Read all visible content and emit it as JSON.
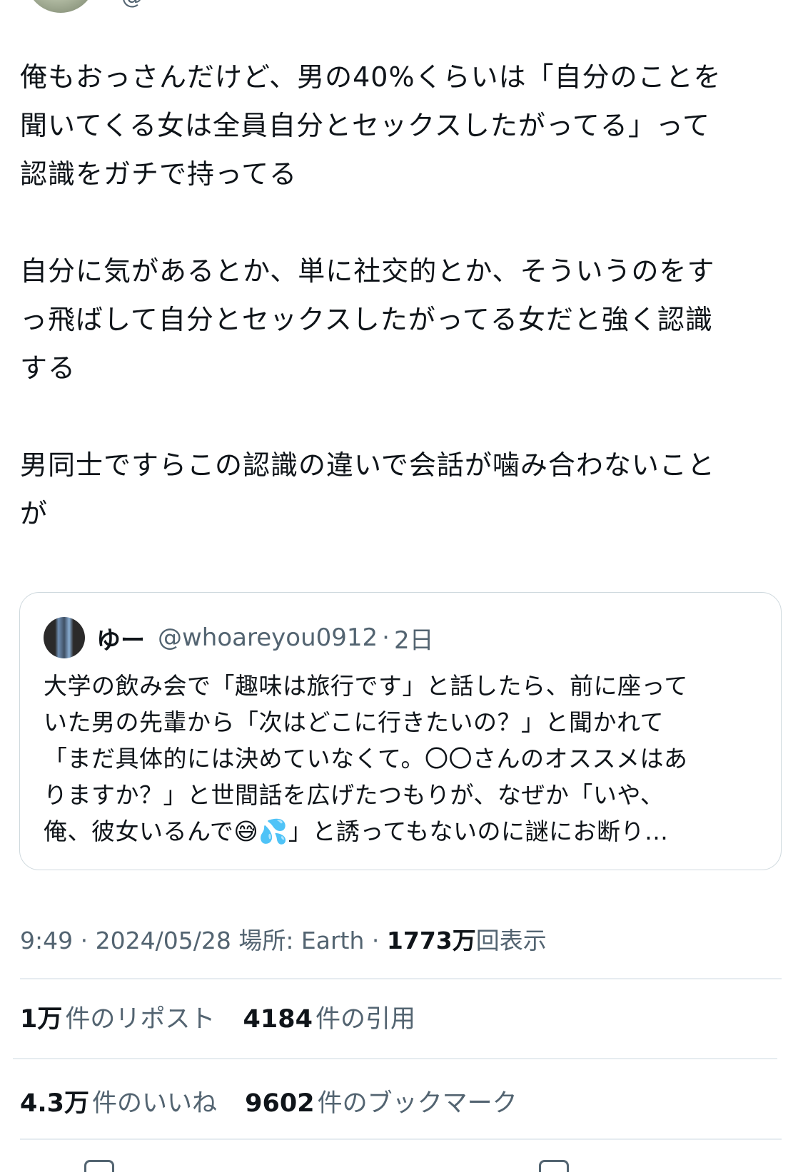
{
  "tweet": {
    "partial_header": "@",
    "text": "俺もおっさんだけど、男の40%くらいは「自分のことを\n聞いてくる女は全員自分とセックスしたがってる」って\n認識をガチで持ってる\n\n自分に気があるとか、単に社交的とか、そういうのをす\nっ飛ばして自分とセックスしたがってる女だと強く認識\nする\n\n男同士ですらこの認識の違いで会話が噛み合わないこと\nが"
  },
  "quote": {
    "display_name": "ゆー",
    "handle": "@whoareyou0912",
    "separator": "·",
    "time": "2日",
    "text": "大学の飲み会で「趣味は旅行です」と話したら、前に座って\nいた男の先輩から「次はどこに行きたいの？」と聞かれて\n「まだ具体的には決めていなくて。〇〇さんのオススメはあ\nりますか？」と世間話を広げたつもりが、なぜか「いや、\n俺、彼女いるんで😅💦」と誘ってもないのに謎にお断り…"
  },
  "meta": {
    "time": "9:49",
    "sep1": "·",
    "date": "2024/05/28",
    "location": "場所: Earth",
    "sep2": "·",
    "views_count": "1773万",
    "views_label": "回表示"
  },
  "stats": {
    "reposts_count": "1万",
    "reposts_label": "件のリポスト",
    "quotes_count": "4184",
    "quotes_label": "件の引用",
    "likes_count": "4.3万",
    "likes_label": "件のいいね",
    "bookmarks_count": "9602",
    "bookmarks_label": "件のブックマーク"
  },
  "colors": {
    "text_primary": "#0f1419",
    "text_secondary": "#536471",
    "border": "#cfd9de",
    "divider": "#e6ecf0"
  }
}
